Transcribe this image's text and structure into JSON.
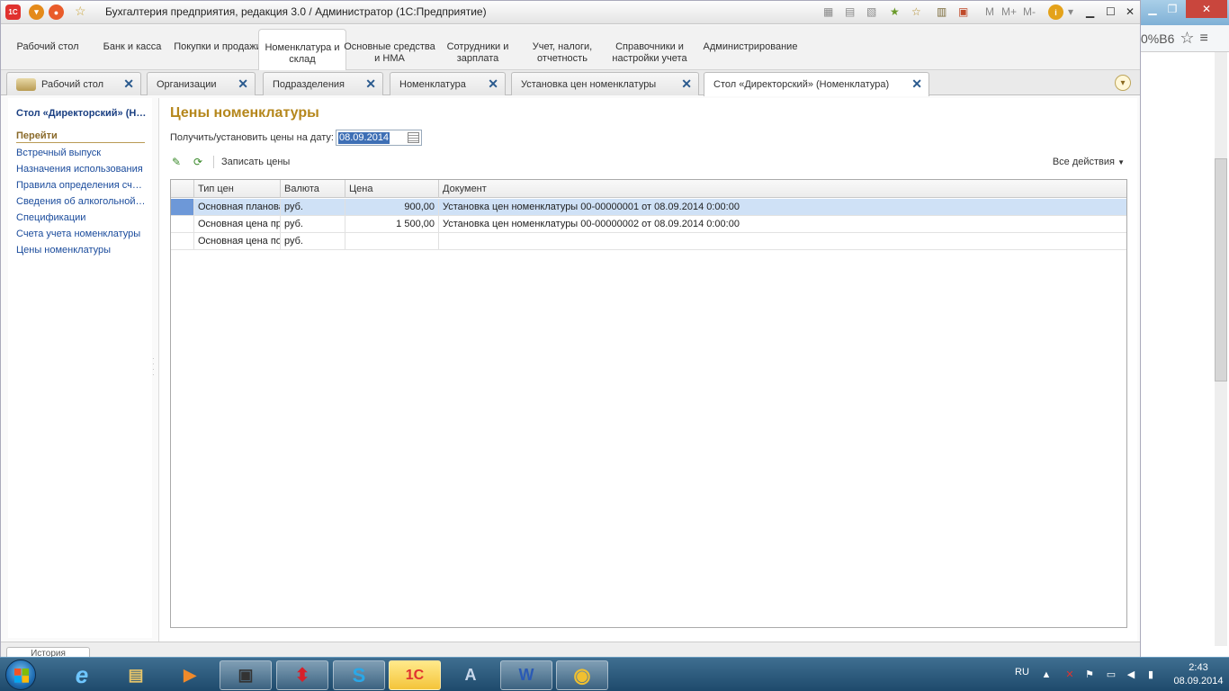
{
  "window": {
    "title": "Бухгалтерия предприятия, редакция 3.0 / Администратор  (1С:Предприятие)",
    "app_icon": "1С",
    "mem_buttons": [
      "M",
      "M+",
      "M-"
    ]
  },
  "background_window": {
    "addr_text": "0%B6"
  },
  "sections": [
    {
      "label": "Рабочий стол"
    },
    {
      "label": "Банк и касса"
    },
    {
      "label": "Покупки и продажи"
    },
    {
      "label": "Номенклатура и склад"
    },
    {
      "label": "Основные средства и НМА"
    },
    {
      "label": "Сотрудники и зарплата"
    },
    {
      "label": "Учет, налоги, отчетность"
    },
    {
      "label": "Справочники и настройки учета"
    },
    {
      "label": "Администрирование"
    }
  ],
  "tabs": [
    {
      "label": "Рабочий стол"
    },
    {
      "label": "Организации"
    },
    {
      "label": "Подразделения"
    },
    {
      "label": "Номенклатура"
    },
    {
      "label": "Установка цен номенклатуры"
    },
    {
      "label": "Стол «Директорский» (Номенклатура)"
    }
  ],
  "left_panel": {
    "title": "Стол «Директорский» (Номенклатура)",
    "goto_label": "Перейти",
    "links": [
      "Встречный выпуск",
      "Назначения использования",
      "Правила определения счетов учета",
      "Сведения об алкогольной продукции",
      "Спецификации",
      "Счета учета номенклатуры",
      "Цены номенклатуры"
    ]
  },
  "content": {
    "heading": "Цены номенклатуры",
    "date_label": "Получить/установить цены на дату:",
    "date_value": "08.09.2014",
    "save_prices_label": "Записать цены",
    "all_actions_label": "Все действия",
    "columns": [
      "Тип цен",
      "Валюта",
      "Цена",
      "Документ"
    ],
    "rows": [
      {
        "type": "Основная плановая цена",
        "currency": "руб.",
        "price": "900,00",
        "document": "Установка цен номенклатуры 00-00000001 от 08.09.2014 0:00:00"
      },
      {
        "type": "Основная цена продажи",
        "currency": "руб.",
        "price": "1 500,00",
        "document": "Установка цен номенклатуры 00-00000002 от 08.09.2014 0:00:00"
      },
      {
        "type": "Основная цена покупки",
        "currency": "руб.",
        "price": "",
        "document": ""
      }
    ]
  },
  "statusbar": {
    "history_label": "История"
  },
  "taskbar": {
    "lang": "RU",
    "time": "2:43",
    "date": "08.09.2014"
  }
}
